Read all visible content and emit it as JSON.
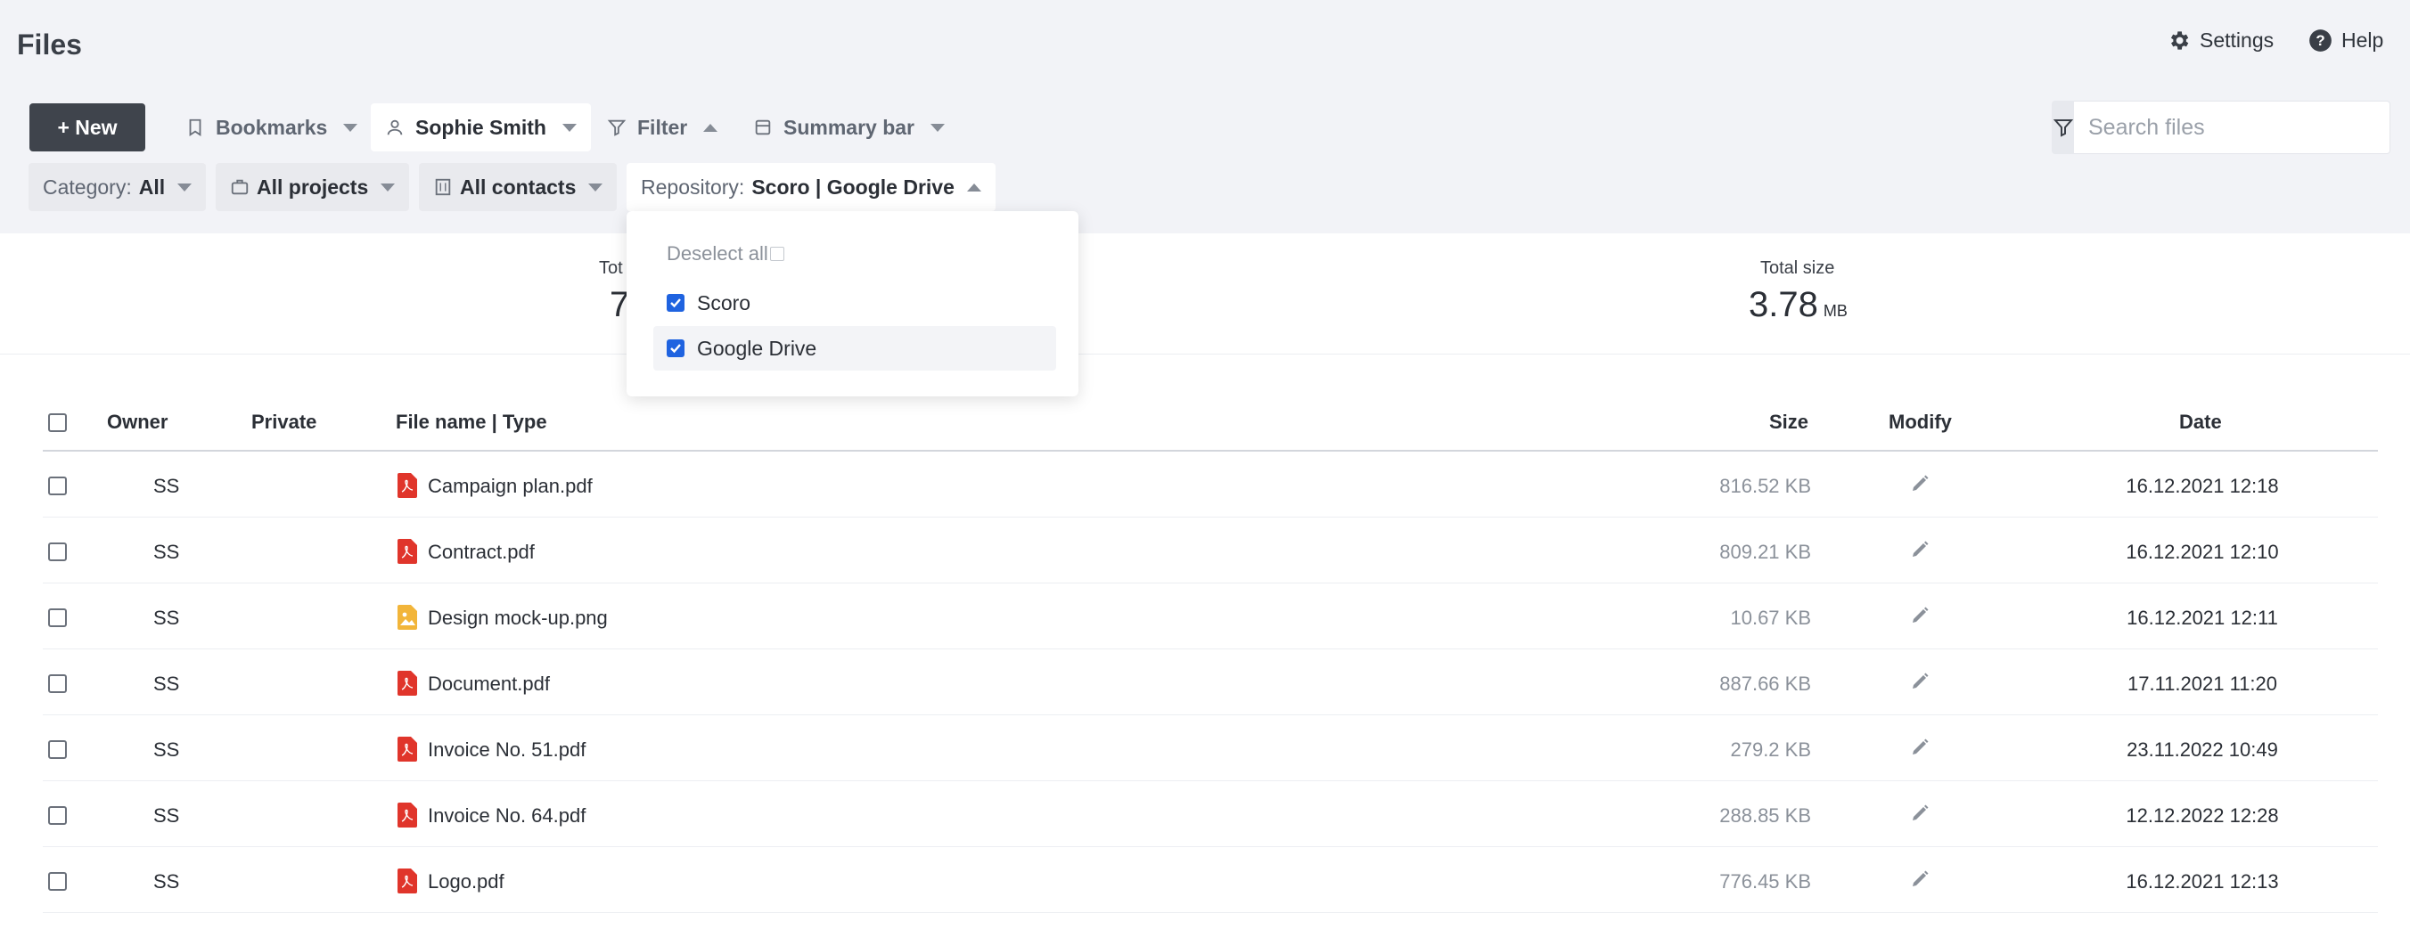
{
  "header": {
    "title": "Files",
    "settings_label": "Settings",
    "help_label": "Help"
  },
  "toolbar": {
    "new_label": "+ New",
    "bookmarks_label": "Bookmarks",
    "user_label": "Sophie Smith",
    "filter_label": "Filter",
    "summary_bar_label": "Summary bar",
    "search_placeholder": "Search files"
  },
  "filters": {
    "category_prefix": "Category:",
    "category_value": "All",
    "projects_label": "All projects",
    "contacts_label": "All contacts",
    "repository_prefix": "Repository:",
    "repository_value": "Scoro | Google Drive"
  },
  "dropdown": {
    "deselect_label": "Deselect all",
    "options": [
      {
        "label": "Scoro",
        "checked": true
      },
      {
        "label": "Google Drive",
        "checked": true
      }
    ]
  },
  "summary": {
    "total_label_visible": "Tot",
    "total_value_visible": "7",
    "size_label": "Total size",
    "size_value": "3.78",
    "size_unit": "MB"
  },
  "table": {
    "columns": {
      "owner": "Owner",
      "private": "Private",
      "file_name": "File name | Type",
      "size": "Size",
      "modify": "Modify",
      "date": "Date"
    },
    "rows": [
      {
        "owner": "SS",
        "name": "Campaign plan.pdf",
        "type": "pdf",
        "size": "816.52 KB",
        "date": "16.12.2021 12:18"
      },
      {
        "owner": "SS",
        "name": "Contract.pdf",
        "type": "pdf",
        "size": "809.21 KB",
        "date": "16.12.2021 12:10"
      },
      {
        "owner": "SS",
        "name": "Design mock-up.png",
        "type": "image",
        "size": "10.67 KB",
        "date": "16.12.2021 12:11"
      },
      {
        "owner": "SS",
        "name": "Document.pdf",
        "type": "pdf",
        "size": "887.66 KB",
        "date": "17.11.2021 11:20"
      },
      {
        "owner": "SS",
        "name": "Invoice No. 51.pdf",
        "type": "pdf",
        "size": "279.2 KB",
        "date": "23.11.2022 10:49"
      },
      {
        "owner": "SS",
        "name": "Invoice No. 64.pdf",
        "type": "pdf",
        "size": "288.85 KB",
        "date": "12.12.2022 12:28"
      },
      {
        "owner": "SS",
        "name": "Logo.pdf",
        "type": "pdf",
        "size": "776.45 KB",
        "date": "16.12.2021 12:13"
      }
    ]
  },
  "colors": {
    "pdf_icon": "#e0352b",
    "image_icon": "#f2b53a",
    "checkbox_checked": "#1f63e0",
    "new_button": "#3f444c"
  }
}
